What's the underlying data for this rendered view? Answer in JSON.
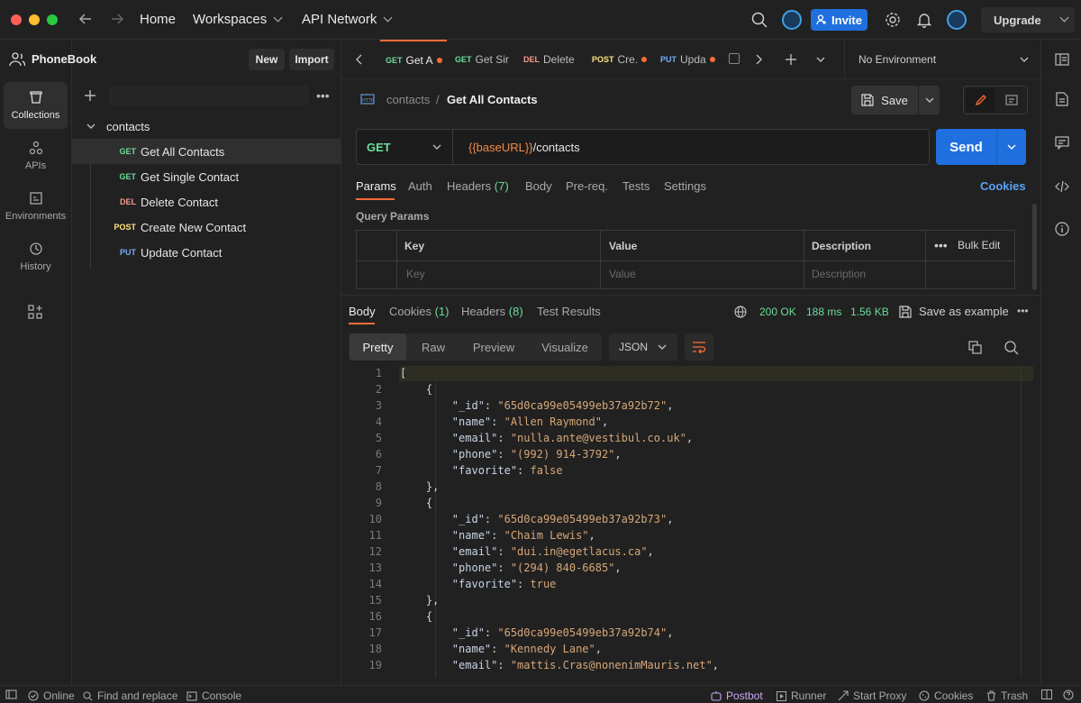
{
  "titlebar": {
    "home": "Home",
    "workspaces": "Workspaces",
    "api_network": "API Network",
    "invite": "Invite",
    "upgrade": "Upgrade"
  },
  "rail": {
    "items": [
      {
        "label": "Collections"
      },
      {
        "label": "APIs"
      },
      {
        "label": "Environments"
      },
      {
        "label": "History"
      }
    ]
  },
  "sidebar": {
    "workspace": "PhoneBook",
    "new_label": "New",
    "import_label": "Import",
    "collection": "contacts",
    "requests": [
      {
        "method": "GET",
        "name": "Get All Contacts"
      },
      {
        "method": "GET",
        "name": "Get Single Contact"
      },
      {
        "method": "DEL",
        "name": "Delete Contact"
      },
      {
        "method": "POST",
        "name": "Create New Contact"
      },
      {
        "method": "PUT",
        "name": "Update Contact"
      }
    ]
  },
  "tabs": {
    "items": [
      {
        "method": "GET",
        "label": "Get A"
      },
      {
        "method": "GET",
        "label": "Get Sir"
      },
      {
        "method": "DEL",
        "label": "Delete"
      },
      {
        "method": "POST",
        "label": "Cre."
      },
      {
        "method": "PUT",
        "label": "Upda"
      }
    ],
    "environment": "No Environment"
  },
  "request": {
    "breadcrumb_parent": "contacts",
    "breadcrumb_sep": "/",
    "title": "Get All Contacts",
    "save_label": "Save",
    "method": "GET",
    "url_var": "{{baseURL}}",
    "url_path": "/contacts",
    "send_label": "Send",
    "tabs": [
      "Params",
      "Auth",
      "Headers",
      "Body",
      "Pre-req.",
      "Tests",
      "Settings"
    ],
    "headers_count": "(7)",
    "cookies_label": "Cookies",
    "query_params_label": "Query Params",
    "table": {
      "headers": [
        "Key",
        "Value",
        "Description"
      ],
      "bulk_edit": "Bulk Edit",
      "placeholders": [
        "Key",
        "Value",
        "Description"
      ]
    }
  },
  "response": {
    "tabs": [
      "Body",
      "Cookies",
      "Headers",
      "Test Results"
    ],
    "cookies_count": "(1)",
    "headers_count": "(8)",
    "status": "200 OK",
    "time": "188 ms",
    "size": "1.56 KB",
    "save_example": "Save as example",
    "views": [
      "Pretty",
      "Raw",
      "Preview",
      "Visualize"
    ],
    "format": "JSON"
  },
  "code": {
    "lines": [
      "[",
      "    {",
      "        \"_id\": \"65d0ca99e05499eb37a92b72\",",
      "        \"name\": \"Allen Raymond\",",
      "        \"email\": \"nulla.ante@vestibul.co.uk\",",
      "        \"phone\": \"(992) 914-3792\",",
      "        \"favorite\": false",
      "    },",
      "    {",
      "        \"_id\": \"65d0ca99e05499eb37a92b73\",",
      "        \"name\": \"Chaim Lewis\",",
      "        \"email\": \"dui.in@egetlacus.ca\",",
      "        \"phone\": \"(294) 840-6685\",",
      "        \"favorite\": true",
      "    },",
      "    {",
      "        \"_id\": \"65d0ca99e05499eb37a92b74\",",
      "        \"name\": \"Kennedy Lane\",",
      "        \"email\": \"mattis.Cras@nonenimMauris.net\","
    ]
  },
  "status": {
    "online": "Online",
    "find_replace": "Find and replace",
    "console": "Console",
    "postbot": "Postbot",
    "runner": "Runner",
    "start_proxy": "Start Proxy",
    "cookies": "Cookies",
    "trash": "Trash"
  }
}
